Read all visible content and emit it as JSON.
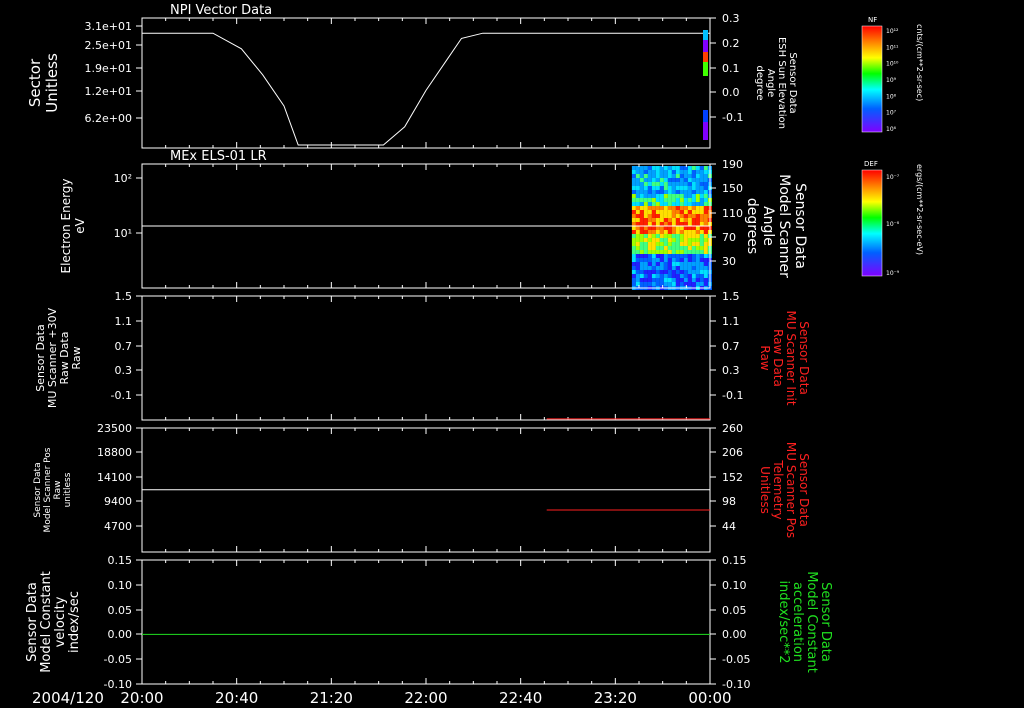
{
  "date_label": "2004/120",
  "time_ticks": [
    "20:00",
    "20:40",
    "21:20",
    "22:00",
    "22:40",
    "23:20",
    "00:00"
  ],
  "colors": {
    "axes": "#ffffff",
    "red": "#ff2020",
    "green": "#20e020",
    "background": "#000000"
  },
  "colorbars": [
    {
      "id": "nf",
      "title": "NF",
      "unit_label": "cnts/(cm**2-sr-sec)",
      "tick_labels": [
        "10¹²",
        "10¹¹",
        "10¹⁰",
        "10⁹",
        "10⁸",
        "10⁷",
        "10⁶"
      ]
    },
    {
      "id": "def",
      "title": "DEF",
      "unit_label": "ergs/(cm**2-sr-sec-eV)",
      "tick_labels": [
        "10⁻⁷",
        "10⁻⁸",
        "10⁻⁹"
      ]
    }
  ],
  "chart_data": [
    {
      "type": "line",
      "title": "NPI Vector Data",
      "ylabel_left": [
        "Sector",
        "Unitless"
      ],
      "ylabel_right": [
        "Sensor Data",
        "ESH Sun Elevation",
        "Angle",
        "degree"
      ],
      "left_ticks": [
        "3.1e+01",
        "2.5e+01",
        "1.9e+01",
        "1.2e+01",
        "6.2e+00"
      ],
      "right_ticks": [
        "0.3",
        "0.2",
        "0.1",
        "0.0",
        "-0.1"
      ],
      "ylim_right": [
        -0.2,
        0.3
      ],
      "series": [
        {
          "x_hours": [
            0,
            0.5,
            0.7,
            0.85,
            1.0,
            1.1,
            1.7,
            1.85,
            2.0,
            2.15,
            2.25,
            2.4,
            2.65,
            2.8,
            4.0
          ],
          "y": [
            0.28,
            0.28,
            0.22,
            0.12,
            0.0,
            -0.15,
            -0.15,
            -0.08,
            0.06,
            0.18,
            0.26,
            0.28,
            0.28,
            0.28,
            0.28
          ],
          "color": "#ffffff"
        }
      ]
    },
    {
      "type": "heatmap",
      "title": "MEx ELS-01 LR",
      "ylabel_left": [
        "Electron Energy",
        "eV"
      ],
      "ylabel_right": [
        "Sensor Data",
        "Model Scanner",
        "Angle",
        "degrees"
      ],
      "left_ticks": [
        "10²",
        "10¹"
      ],
      "right_ticks": [
        "190",
        "150",
        "110",
        "70",
        "30"
      ],
      "reference_line_eV": 14,
      "data_start_hours": 3.45
    },
    {
      "type": "line",
      "ylabel_left": [
        "Sensor Data",
        "MU Scanner +30V",
        "Raw Data",
        "Raw"
      ],
      "ylabel_right": [
        "Sensor Data",
        "MU Scanner Init",
        "Raw Data",
        "Raw"
      ],
      "left_ticks": [
        "1.5",
        "1.1",
        "0.7",
        "0.3",
        "-0.1"
      ],
      "right_ticks": [
        "1.5",
        "1.1",
        "0.7",
        "0.3",
        "-0.1"
      ],
      "ylim": [
        -0.4,
        1.5
      ],
      "series": [
        {
          "x_hours": [
            2.85,
            4.0
          ],
          "y": [
            0.0,
            0.0
          ],
          "color": "#ff2020"
        }
      ]
    },
    {
      "type": "line",
      "ylabel_left": [
        "Sensor Data",
        "Model Scanner Pos",
        "Raw",
        "unitless"
      ],
      "ylabel_right": [
        "Sensor Data",
        "MU Scanner Pos",
        "Telemetry",
        "Unitless"
      ],
      "left_ticks": [
        "23500",
        "18800",
        "14100",
        "9400",
        "4700"
      ],
      "right_ticks": [
        "260",
        "206",
        "152",
        "98",
        "44"
      ],
      "ylim_left": [
        0,
        23500
      ],
      "ylim_right": [
        0,
        260
      ],
      "series": [
        {
          "x_hours": [
            0,
            4.0
          ],
          "y_left": [
            11800,
            11800
          ],
          "color": "#ffffff"
        },
        {
          "x_hours": [
            2.85,
            4.0
          ],
          "y_right": [
            88,
            88
          ],
          "color": "#ff2020"
        }
      ]
    },
    {
      "type": "line",
      "ylabel_left": [
        "Sensor Data",
        "Model Constant",
        "velocity",
        "index/sec"
      ],
      "ylabel_right": [
        "Sensor Data",
        "Model Constant",
        "acceleration",
        "index/sec**2"
      ],
      "left_ticks": [
        "0.15",
        "0.10",
        "0.05",
        "0.00",
        "-0.05",
        "-0.10"
      ],
      "right_ticks": [
        "0.15",
        "0.10",
        "0.05",
        "0.00",
        "-0.05",
        "-0.10"
      ],
      "ylim": [
        -0.1,
        0.15
      ],
      "series": [
        {
          "x_hours": [
            0,
            4.0
          ],
          "y": [
            0.0,
            0.0
          ],
          "color": "#20e020"
        }
      ]
    }
  ]
}
